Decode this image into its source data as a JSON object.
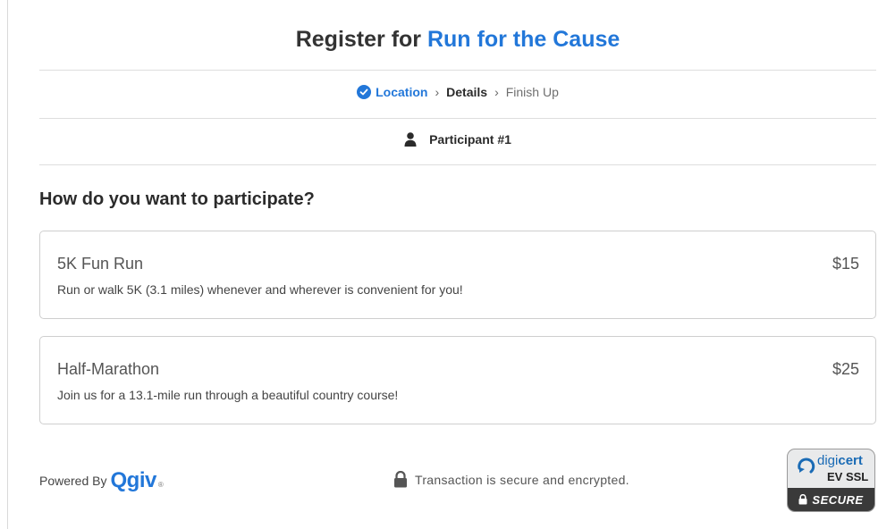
{
  "header": {
    "title_prefix": "Register for",
    "event_name": "Run for the Cause"
  },
  "steps": {
    "current": "Location",
    "next": "Details",
    "last": "Finish Up",
    "separator": "›"
  },
  "participant": {
    "label": "Participant #1",
    "icon": "user-icon"
  },
  "question": "How do you want to participate?",
  "options": [
    {
      "name": "5K Fun Run",
      "price": "$15",
      "description": "Run or walk 5K (3.1 miles) whenever and wherever is convenient for you!"
    },
    {
      "name": "Half-Marathon",
      "price": "$25",
      "description": "Join us for a 13.1-mile run through a beautiful country course!"
    }
  ],
  "footer": {
    "powered_by": "Powered By",
    "brand": "Qgiv",
    "registered_mark": "®",
    "secure_text": "Transaction is secure and encrypted.",
    "badge": {
      "brand_light": "digi",
      "brand_bold": "cert",
      "cert_type": "EV SSL",
      "status": "SECURE"
    }
  },
  "colors": {
    "accent": "#2277d9",
    "border": "#cfcfcf",
    "text": "#2b2b2b"
  }
}
